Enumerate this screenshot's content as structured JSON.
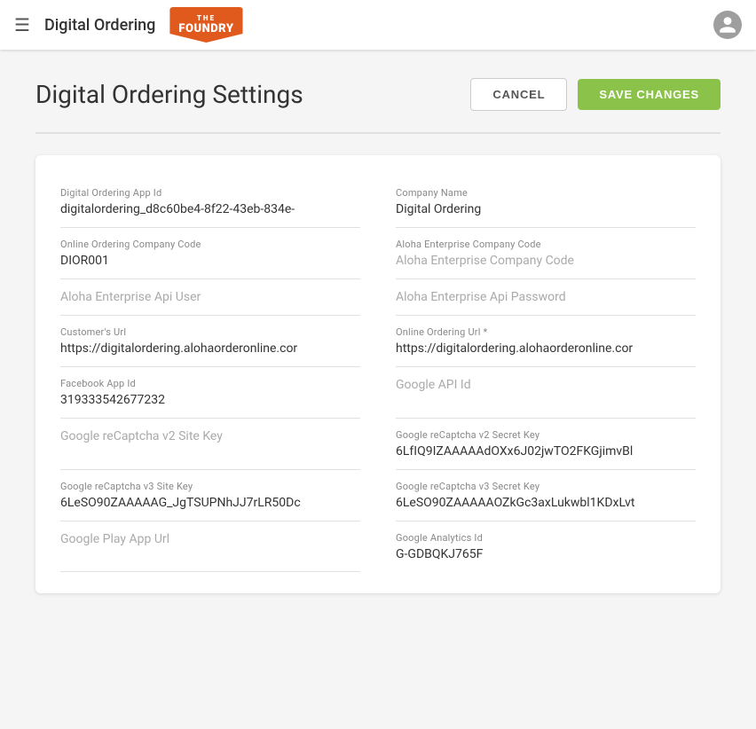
{
  "topnav": {
    "menu_icon": "☰",
    "title": "Digital Ordering",
    "logo_the": "THE",
    "logo_foundry": "FOUNDRY",
    "avatar_icon": "person"
  },
  "page": {
    "title": "Digital Ordering Settings",
    "cancel_label": "CANCEL",
    "save_label": "SAVE CHANGES"
  },
  "fields": [
    {
      "col": 0,
      "label": "Digital Ordering App Id",
      "value": "digitalordering_d8c60be4-8f22-43eb-834e-",
      "placeholder": false
    },
    {
      "col": 1,
      "label": "Company Name",
      "value": "Digital Ordering",
      "placeholder": false
    },
    {
      "col": 0,
      "label": "Online Ordering Company Code",
      "value": "DIOR001",
      "placeholder": false
    },
    {
      "col": 1,
      "label": "Aloha Enterprise Company Code",
      "value": "",
      "placeholder": true,
      "placeholder_text": "Aloha Enterprise Company Code"
    },
    {
      "col": 0,
      "label": "",
      "value": "",
      "placeholder": true,
      "placeholder_text": "Aloha Enterprise Api User"
    },
    {
      "col": 1,
      "label": "",
      "value": "",
      "placeholder": true,
      "placeholder_text": "Aloha Enterprise Api Password"
    },
    {
      "col": 0,
      "label": "Customer's Url",
      "value": "https://digitalordering.alohaorderonline.cor",
      "placeholder": false
    },
    {
      "col": 1,
      "label": "Online Ordering Url *",
      "value": "https://digitalordering.alohaorderonline.cor",
      "placeholder": false
    },
    {
      "col": 0,
      "label": "Facebook App Id",
      "value": "319333542677232",
      "placeholder": false
    },
    {
      "col": 1,
      "label": "",
      "value": "",
      "placeholder": true,
      "placeholder_text": "Google API Id"
    },
    {
      "col": 0,
      "label": "",
      "value": "",
      "placeholder": true,
      "placeholder_text": "Google reCaptcha v2 Site Key"
    },
    {
      "col": 1,
      "label": "Google reCaptcha v2 Secret Key",
      "value": "6LfIQ9IZAAAAAdOXx6J02jwTO2FKGjimvBl",
      "placeholder": false
    },
    {
      "col": 0,
      "label": "Google reCaptcha v3 Site Key",
      "value": "6LeSO90ZAAAAAG_JgTSUPNhJJ7rLR50Dc",
      "placeholder": false
    },
    {
      "col": 1,
      "label": "Google reCaptcha v3 Secret Key",
      "value": "6LeSO90ZAAAAAOZkGc3axLukwbl1KDxLvt",
      "placeholder": false
    },
    {
      "col": 0,
      "label": "",
      "value": "",
      "placeholder": true,
      "placeholder_text": "Google Play App Url"
    },
    {
      "col": 1,
      "label": "Google Analytics Id",
      "value": "G-GDBQKJ765F",
      "placeholder": false
    }
  ],
  "colors": {
    "accent_green": "#8bc34a",
    "accent_orange": "#e05a1e"
  }
}
